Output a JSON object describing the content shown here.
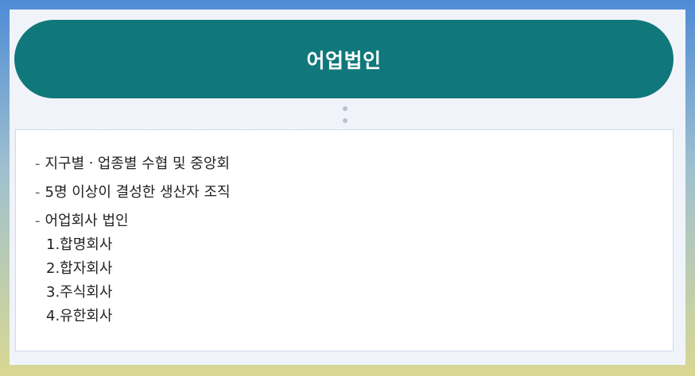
{
  "header": {
    "title": "어업법인"
  },
  "list": {
    "bullet": "-",
    "items": [
      "지구별ㆍ업종별 수협 및 중앙회",
      "5명 이상이 결성한 생산자 조직",
      "어업회사 법인"
    ],
    "sub_items": [
      "1.합명회사",
      "2.합자회사",
      "3.주식회사",
      "4.유한회사"
    ]
  },
  "colors": {
    "header_bg": "#10787a",
    "panel_bg": "#f0f4fa",
    "text": "#222222"
  }
}
